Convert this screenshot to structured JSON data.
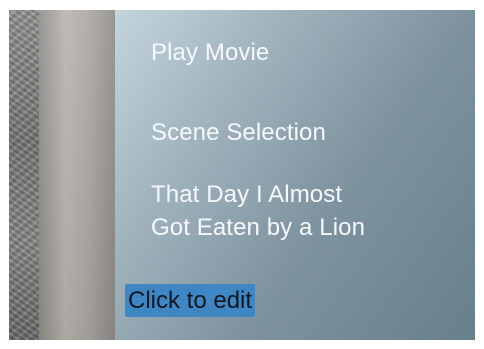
{
  "menu": {
    "play_movie": "Play Movie",
    "scene_selection": "Scene Selection",
    "chapter_title_line1": "That Day I Almost",
    "chapter_title_line2": "Got Eaten by a Lion"
  },
  "edit_label": "Click to edit",
  "colors": {
    "highlight": "#3f87c4",
    "menu_text": "#f6f9fb",
    "panel": "#7e939f"
  }
}
